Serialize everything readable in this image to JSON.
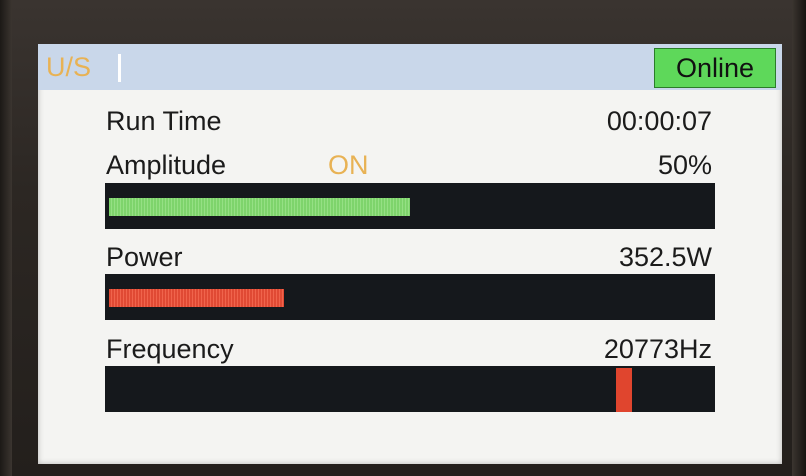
{
  "title_bar": {
    "mode_label": "U/S",
    "status_badge": "Online"
  },
  "colors": {
    "title_bar_bg": "#c9d7ea",
    "online_green": "#5ed85a",
    "accent_amber": "#e8b254",
    "amplitude_bar": "#7ed46c",
    "power_bar": "#e04a34",
    "frequency_marker": "#e0452e",
    "bar_track": "#15181c"
  },
  "run_time": {
    "label": "Run Time",
    "value": "00:00:07"
  },
  "amplitude": {
    "label": "Amplitude",
    "state": "ON",
    "value": "50%",
    "level": 0.5
  },
  "power": {
    "label": "Power",
    "value": "352.5W",
    "level": 0.29
  },
  "frequency": {
    "label": "Frequency",
    "value": "20773Hz",
    "marker_position": 0.86
  }
}
